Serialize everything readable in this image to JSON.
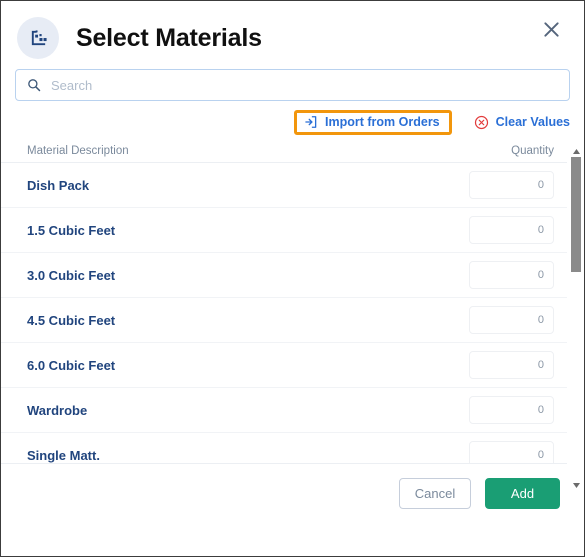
{
  "dialog": {
    "title": "Select Materials",
    "header_icon": "materials-box-icon",
    "close_icon": "close-icon"
  },
  "search": {
    "placeholder": "Search",
    "value": "",
    "icon": "search-icon"
  },
  "actions": {
    "import": {
      "label": "Import from Orders",
      "icon": "import-arrow-icon",
      "highlight_color": "#f2960c",
      "text_color": "#2a6fd6"
    },
    "clear": {
      "label": "Clear Values",
      "icon": "circle-x-icon",
      "icon_color": "#e23b3b",
      "text_color": "#2a6fd6"
    }
  },
  "table": {
    "columns": {
      "description": "Material Description",
      "quantity": "Quantity"
    },
    "rows": [
      {
        "name": "Dish Pack",
        "quantity": "0"
      },
      {
        "name": "1.5 Cubic Feet",
        "quantity": "0"
      },
      {
        "name": "3.0 Cubic Feet",
        "quantity": "0"
      },
      {
        "name": "4.5 Cubic Feet",
        "quantity": "0"
      },
      {
        "name": "6.0 Cubic Feet",
        "quantity": "0"
      },
      {
        "name": "Wardrobe",
        "quantity": "0"
      },
      {
        "name": "Single Matt.",
        "quantity": "0"
      }
    ]
  },
  "scrollbar": {
    "up_icon": "scroll-up-arrow-icon",
    "down_icon": "scroll-down-arrow-icon"
  },
  "footer": {
    "cancel_label": "Cancel",
    "add_label": "Add",
    "add_color": "#1a9e74"
  }
}
